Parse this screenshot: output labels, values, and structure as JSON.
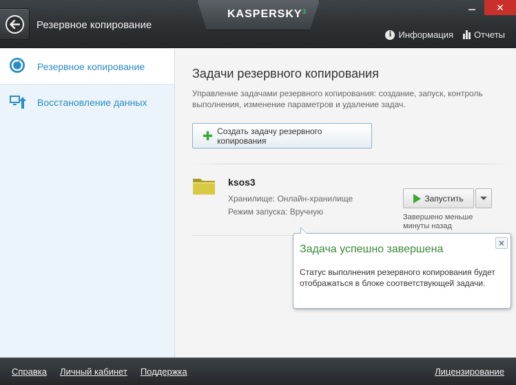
{
  "header": {
    "title": "Резервное копирование",
    "logo_text": "KASPERSKY",
    "logo_sup": "3",
    "links": {
      "info": "Информация",
      "reports": "Отчеты"
    },
    "close_glyph": "✕"
  },
  "sidebar": {
    "items": [
      {
        "label": "Резервное копирование",
        "icon": "backup-icon",
        "active": true
      },
      {
        "label": "Восстановление данных",
        "icon": "restore-icon",
        "active": false
      }
    ]
  },
  "main": {
    "title": "Задачи резервного копирования",
    "description": "Управление задачами резервного копирования: создание, запуск, контроль выполнения, изменение параметров и удаление задач.",
    "create_button": "Создать задачу резервного копирования",
    "task": {
      "name": "ksos3",
      "storage": "Хранилище: Онлайн-хранилище",
      "mode": "Режим запуска: Вручную",
      "run_button": "Запустить",
      "status": "Завершено меньше минуты назад"
    }
  },
  "popup": {
    "title": "Задача успешно завершена",
    "body": "Статус выполнения резервного копирования будет отображаться в блоке соответствующей задачи.",
    "close_glyph": "✕"
  },
  "footer": {
    "help": "Справка",
    "account": "Личный кабинет",
    "support": "Поддержка",
    "licensing": "Лицензирование"
  },
  "colors": {
    "accent": "#2b8cc4",
    "success": "#3a8a3a",
    "green_icon": "#3aaa35",
    "close_red": "#c9302c"
  }
}
